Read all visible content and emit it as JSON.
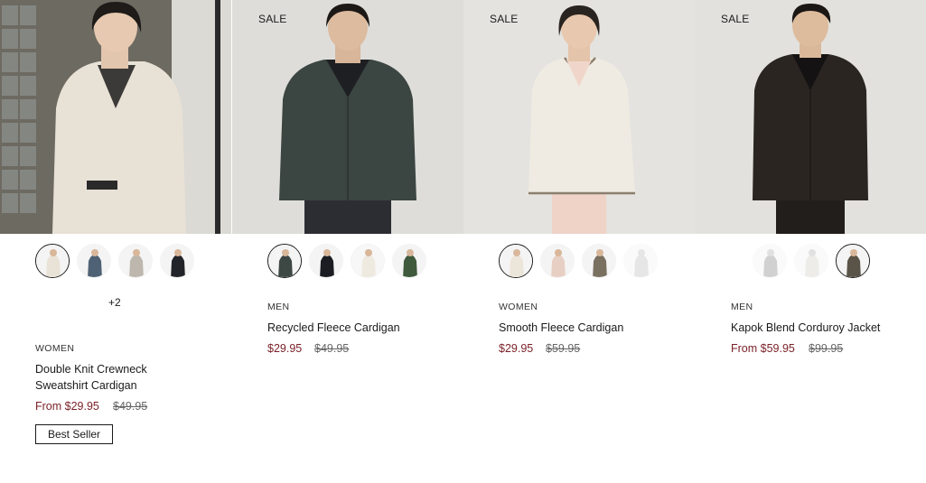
{
  "products": [
    {
      "sale_tag": "",
      "gender": "WOMEN",
      "name_line1": "Double Knit Crewneck",
      "name_line2": "Sweatshirt Cardigan",
      "price": "From $29.95",
      "old_price": "$49.95",
      "more_colors": "+2",
      "badge": "Best Seller",
      "swatch_colors": [
        "#e9e2d6",
        "#4f6275",
        "#bdb7ad",
        "#23232a"
      ],
      "photo_bg": "#6d6a62",
      "garment_color": "#e8e1d6"
    },
    {
      "sale_tag": "SALE",
      "gender": "MEN",
      "name_line1": "Recycled Fleece Cardigan",
      "price": "$29.95",
      "old_price": "$49.95",
      "swatch_colors": [
        "#3d4744",
        "#1b1d22",
        "#efeae0",
        "#3f5a3c"
      ],
      "photo_bg": "#deddd9",
      "garment_color": "#3b4542"
    },
    {
      "sale_tag": "SALE",
      "gender": "WOMEN",
      "name_line1": "Smooth Fleece Cardigan",
      "price": "$29.95",
      "old_price": "$59.95",
      "swatch_colors": [
        "#ece5d9",
        "#e8cfc4",
        "#7a7060",
        "#c9cacb"
      ],
      "photo_bg": "#e4e3df",
      "garment_color": "#efebe2"
    },
    {
      "sale_tag": "SALE",
      "gender": "MEN",
      "name_line1": "Kapok Blend Corduroy Jacket",
      "price": "From $59.95",
      "old_price": "$99.95",
      "swatch_colors": [
        "#9a9a9a",
        "#d8d6d0",
        "#5a5347"
      ],
      "photo_bg": "#e2e1dd",
      "garment_color": "#2b2522"
    }
  ]
}
